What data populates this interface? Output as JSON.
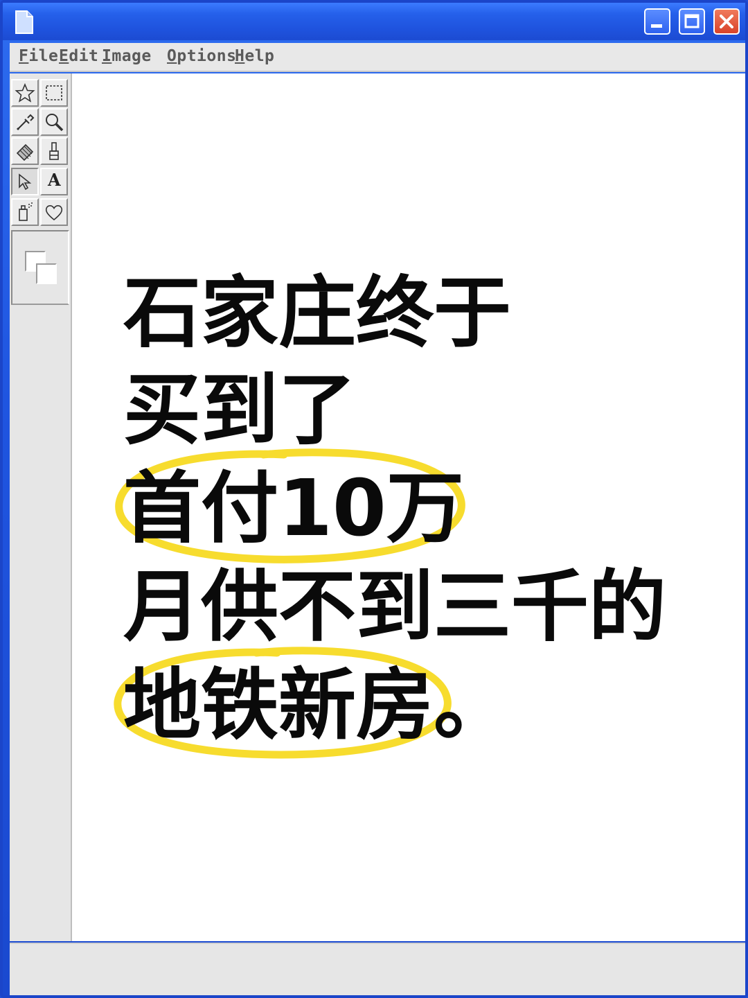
{
  "menubar": {
    "items": [
      {
        "accel": "F",
        "rest": "ile"
      },
      {
        "accel": "E",
        "rest": "dit"
      },
      {
        "accel": "I",
        "rest": "mage"
      },
      {
        "accel": "O",
        "rest": "ptions"
      },
      {
        "accel": "H",
        "rest": "elp"
      }
    ]
  },
  "toolbox": {
    "tools": [
      "star-shape",
      "rect-select",
      "eyedropper",
      "magnifier",
      "eraser",
      "brush",
      "pointer",
      "text",
      "spray",
      "heart-shape"
    ],
    "text_tool_glyph": "A"
  },
  "canvas": {
    "lines": [
      "石家庄终于",
      "买到了",
      "首付10万",
      "月供不到三千的",
      "地铁新房。"
    ],
    "highlight_color": "#f7dc2e"
  }
}
